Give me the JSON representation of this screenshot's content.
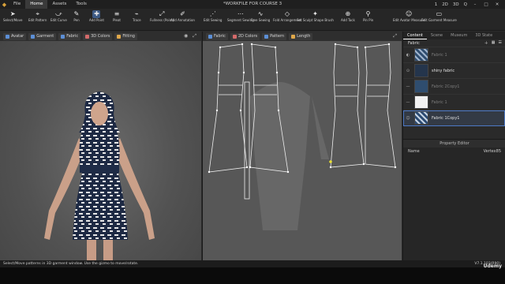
{
  "menu": {
    "items": [
      "File",
      "Home",
      "Assets",
      "Tools"
    ],
    "active": "Home"
  },
  "window": {
    "title": "*WORKFILE FOR COURSE 3",
    "layout_buttons": [
      "1",
      "2D",
      "3D",
      "Q"
    ],
    "win_controls": [
      "–",
      "□",
      "✕"
    ]
  },
  "toolbar": {
    "tools": [
      {
        "label": "Select/Move",
        "icon": "arrow"
      },
      {
        "label": "Edit Pattern",
        "icon": "cursor"
      },
      {
        "label": "Edit Curve",
        "icon": "curve"
      },
      {
        "label": "Pen",
        "icon": "pen"
      },
      {
        "label": "Add Point",
        "icon": "add-point"
      },
      {
        "label": "Pleat",
        "icon": "pleat"
      },
      {
        "label": "Trace",
        "icon": "trace"
      },
      {
        "label": "Fullness (Point)",
        "icon": "fullness"
      },
      {
        "label": "Add Annotation",
        "icon": "annotation"
      },
      {
        "label": "Edit Sewing",
        "icon": "sewing"
      },
      {
        "label": "Segment Sewing",
        "icon": "segment"
      },
      {
        "label": "Free Sewing",
        "icon": "free"
      },
      {
        "label": "Fold Arrangement",
        "icon": "fold"
      },
      {
        "label": "Set Sculpt Shape Brush",
        "icon": "brush"
      },
      {
        "label": "Add Tack",
        "icon": "tack"
      },
      {
        "label": "Pin Pin",
        "icon": "pin"
      },
      {
        "label": "Edit Avatar Measure",
        "icon": "avatar"
      },
      {
        "label": "Edit Garment Measure",
        "icon": "measure"
      }
    ]
  },
  "view3d": {
    "buttons": [
      "Avatar",
      "Garment",
      "Fabric",
      "3D Colors",
      "Fitting"
    ]
  },
  "view2d": {
    "buttons": [
      "Fabric",
      "2D Colors",
      "Pattern",
      "Length"
    ]
  },
  "right_panel": {
    "tabs": [
      "Content",
      "Scene",
      "Museum",
      "3D State"
    ],
    "section_title": "Fabric",
    "fabrics": [
      {
        "label": "Fabric 1",
        "dim": true,
        "swatch": "#2f4d6f"
      },
      {
        "label": "shiny fabric",
        "dim": false,
        "swatch": "#24354c"
      },
      {
        "label": "Fabric 2Copy1",
        "dim": true,
        "swatch": "#2f4d6f"
      },
      {
        "label": "Fabric 1",
        "dim": true,
        "swatch": "#f2f2f2"
      },
      {
        "label": "Fabric 1Copy1",
        "dim": false,
        "swatch": "#2b4a72",
        "selected": true
      }
    ],
    "property_editor": {
      "title": "Property Editor",
      "name_label": "Name",
      "name_value": "Vertex85"
    }
  },
  "status": {
    "text": "Select/Move patterns in 3D garment window. Use the gizmo to move/rotate.",
    "version": "V7.1.103(R90)"
  },
  "watermark": "Udemy"
}
